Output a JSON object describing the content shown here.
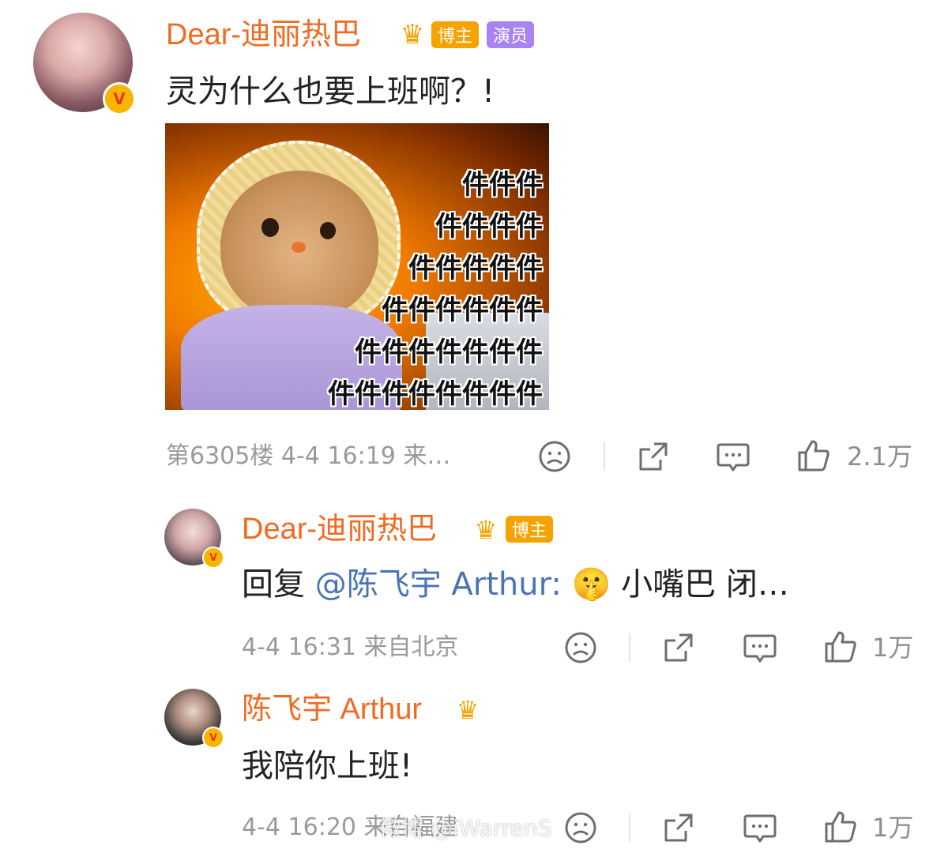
{
  "comments": [
    {
      "username": "Dear-迪丽热巴",
      "tags": [
        "博主",
        "演员"
      ],
      "text": "灵为什么也要上班啊？!",
      "meta": "第6305楼 4-4 16:19 来…",
      "likes": "2.1万",
      "meme": {
        "lines": [
          "件件件",
          "件件件件",
          "件件件件件",
          "件件件件件件",
          "件件件件件件件",
          "件件件件件件件件"
        ]
      }
    },
    {
      "username": "Dear-迪丽热巴",
      "tags": [
        "博主"
      ],
      "reply_prefix": "回复",
      "mention": "@陈飞宇 Arthur:",
      "emoji": "🤫",
      "text": "小嘴巴 闭…",
      "meta": "4-4 16:31 来自北京",
      "likes": "1万"
    },
    {
      "username": "陈飞宇 Arthur",
      "tags": [],
      "text": "我陪你上班!",
      "meta": "4-4 16:20 来自福建",
      "likes": "1万"
    }
  ],
  "watermark": "微博 @iWarrenS",
  "badge_letter": "V",
  "crown_mark": "♛",
  "icons": {
    "dislike": "sad-face-icon",
    "share": "share-icon",
    "comment": "comment-icon",
    "like": "thumbs-up-icon"
  },
  "colors": {
    "username": "#f26a21",
    "host_tag": "#f5a300",
    "actor_tag": "#a883f2",
    "mention": "#4a74b5",
    "verified": "#f7b500"
  }
}
